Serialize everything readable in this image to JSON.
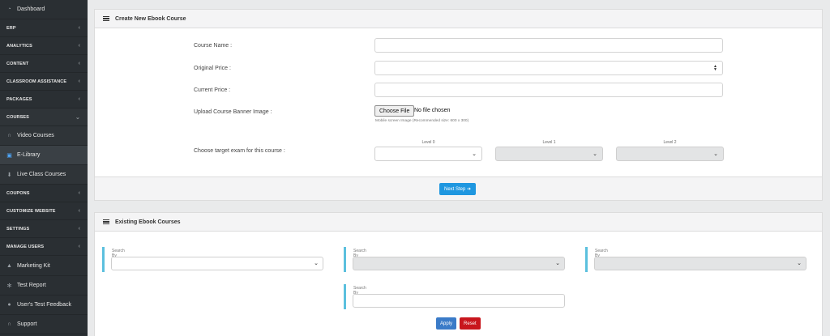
{
  "sidebar": {
    "items": [
      {
        "label": "Dashboard",
        "icon": "dashboard-icon",
        "kind": "sub"
      },
      {
        "label": "ERP",
        "kind": "head",
        "chev": "‹"
      },
      {
        "label": "ANALYTICS",
        "kind": "head",
        "chev": "‹"
      },
      {
        "label": "CONTENT",
        "kind": "head",
        "chev": "‹"
      },
      {
        "label": "CLASSROOM ASSISTANCE",
        "kind": "head",
        "chev": "‹"
      },
      {
        "label": "PACKAGES",
        "kind": "head",
        "chev": "‹"
      },
      {
        "label": "COURSES",
        "kind": "head",
        "chev": "⌄"
      },
      {
        "label": "Video Courses",
        "icon": "headphones-icon",
        "kind": "sub"
      },
      {
        "label": "E-Library",
        "icon": "book-icon",
        "kind": "sub"
      },
      {
        "label": "Live Class Courses",
        "icon": "live-icon",
        "kind": "sub"
      },
      {
        "label": "COUPONS",
        "kind": "head",
        "chev": "‹"
      },
      {
        "label": "CUSTOMIZE WEBSITE",
        "kind": "head",
        "chev": "‹"
      },
      {
        "label": "SETTINGS",
        "kind": "head",
        "chev": "‹"
      },
      {
        "label": "MANAGE USERS",
        "kind": "head",
        "chev": "‹"
      },
      {
        "label": "Marketing Kit",
        "icon": "marketing-icon",
        "kind": "sub"
      },
      {
        "label": "Test Report",
        "icon": "gear-icon",
        "kind": "sub"
      },
      {
        "label": "User's Test Feedback",
        "icon": "chat-icon",
        "kind": "sub"
      },
      {
        "label": "Support",
        "icon": "headset-icon",
        "kind": "sub"
      }
    ]
  },
  "create_panel": {
    "title": "Create New Ebook Course",
    "course_name_label": "Course Name :",
    "original_price_label": "Original Price :",
    "current_price_label": "Current Price :",
    "upload_label": "Upload Course Banner Image :",
    "choose_file": "Choose File",
    "no_file": "No file chosen",
    "hint": "Mobile screen Image (Recommended size: 600 x 300)",
    "target_label": "Choose target exam for this course :",
    "level0": "Level 0",
    "level1": "Level 1",
    "level2": "Level 2",
    "next_step": "Next Step ➔"
  },
  "existing_panel": {
    "title": "Existing Ebook Courses",
    "search_level0": "Search By Level 0",
    "search_level1": "Search By Level 1",
    "search_level2": "Search By Level 2",
    "search_name": "Search By Name",
    "apply": "Apply",
    "reset": "Reset"
  },
  "colors": {
    "sidebar_bg": "#2a2f33",
    "primary": "#1f97e0",
    "apply": "#3a7bc8",
    "reset": "#c8161d",
    "filter_accent": "#5bc0de"
  }
}
